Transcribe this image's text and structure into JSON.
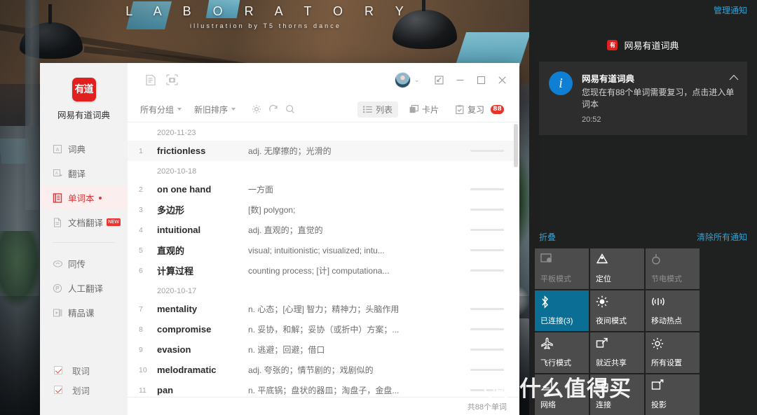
{
  "wallpaper": {
    "banner_title": "L A B O R A T O R Y",
    "banner_subtitle": "illustration by T5 thorns dance"
  },
  "app": {
    "sidebar": {
      "logo_glyph": "有道",
      "brand": "网易有道词典",
      "items": [
        {
          "label": "词典",
          "icon": "dictionary-icon",
          "active": false
        },
        {
          "label": "翻译",
          "icon": "translate-icon",
          "active": false
        },
        {
          "label": "单词本",
          "icon": "wordbook-icon",
          "active": true,
          "dot": true
        },
        {
          "label": "文档翻译",
          "icon": "document-translate-icon",
          "active": false,
          "badge": "NEW"
        },
        {
          "label": "同传",
          "icon": "simultaneous-interpretation-icon",
          "active": false
        },
        {
          "label": "人工翻译",
          "icon": "human-translation-icon",
          "active": false
        },
        {
          "label": "精品课",
          "icon": "course-icon",
          "active": false
        }
      ],
      "checks": [
        {
          "label": "取词",
          "checked": true
        },
        {
          "label": "划词",
          "checked": true
        }
      ]
    },
    "titlebar": {
      "doc_icon": "document-icon",
      "capture_icon": "screenshot-icon",
      "avatar": "user-avatar",
      "chevron": "⌄",
      "feedback_icon": "feedback-icon",
      "minimize": "−",
      "maximize": "▢",
      "close": "✕"
    },
    "toolbar": {
      "group_filter": "所有分组",
      "sort_filter": "新旧排序",
      "settings_icon": "gear-icon",
      "refresh_icon": "refresh-icon",
      "search_icon": "search-icon",
      "view_list": "列表",
      "view_card": "卡片",
      "review": "复习",
      "review_count": "88"
    },
    "list": {
      "groups": [
        {
          "date": "2020-11-23",
          "rows": [
            {
              "index": "1",
              "term": "frictionless",
              "definition": "adj. 无摩擦的；光滑的",
              "highlight": true
            }
          ]
        },
        {
          "date": "2020-10-18",
          "rows": [
            {
              "index": "2",
              "term": "on one hand",
              "definition": "一方面"
            },
            {
              "index": "3",
              "term": "多边形",
              "definition": "[数] polygon;"
            },
            {
              "index": "4",
              "term": "intuitional",
              "definition": "adj. 直观的；直觉的"
            },
            {
              "index": "5",
              "term": "直观的",
              "definition": "visual;  intuitionistic;  visualized;  intu..."
            },
            {
              "index": "6",
              "term": "计算过程",
              "definition": "counting process;  [计] computationa..."
            }
          ]
        },
        {
          "date": "2020-10-17",
          "rows": [
            {
              "index": "7",
              "term": "mentality",
              "definition": "n. 心态；[心理] 智力；精神力；头脑作用"
            },
            {
              "index": "8",
              "term": "compromise",
              "definition": "n. 妥协，和解；妥协（或折中）方案；..."
            },
            {
              "index": "9",
              "term": "evasion",
              "definition": "n. 逃避；回避；借口"
            },
            {
              "index": "10",
              "term": "melodramatic",
              "definition": "adj. 夸张的；情节剧的；戏剧似的"
            },
            {
              "index": "11",
              "term": "pan",
              "definition": "n. 平底锅；盘状的器皿；淘盘子，金盘..."
            }
          ]
        }
      ],
      "status": "共88个单词"
    }
  },
  "action_center": {
    "manage_link": "管理通知",
    "app_name": "网易有道词典",
    "app_icon": "youdao-icon",
    "toast": {
      "icon": "info-icon",
      "title": "网易有道词典",
      "message": "您现在有88个单词需要复习，点击进入单词本",
      "time": "20:52",
      "collapse_icon": "chevron-up-icon"
    },
    "collapse_label": "折叠",
    "clear_label": "清除所有通知",
    "tiles": [
      {
        "label": "平板模式",
        "icon": "tablet-mode-icon",
        "state": "off"
      },
      {
        "label": "定位",
        "icon": "location-icon",
        "state": "normal"
      },
      {
        "label": "节电模式",
        "icon": "battery-saver-icon",
        "state": "off"
      },
      {
        "label": "已连接(3)",
        "icon": "bluetooth-icon",
        "state": "on"
      },
      {
        "label": "夜间模式",
        "icon": "night-light-icon",
        "state": "normal"
      },
      {
        "label": "移动热点",
        "icon": "mobile-hotspot-icon",
        "state": "normal"
      },
      {
        "label": "飞行模式",
        "icon": "airplane-mode-icon",
        "state": "normal"
      },
      {
        "label": "就近共享",
        "icon": "nearby-share-icon",
        "state": "normal"
      },
      {
        "label": "所有设置",
        "icon": "settings-gear-icon",
        "state": "normal"
      },
      {
        "label": "网络",
        "icon": "network-icon",
        "state": "normal"
      },
      {
        "label": "连接",
        "icon": "connect-icon",
        "state": "normal"
      },
      {
        "label": "投影",
        "icon": "project-icon",
        "state": "normal"
      }
    ]
  },
  "watermark": {
    "mark": "值",
    "text": "什么值得买"
  }
}
